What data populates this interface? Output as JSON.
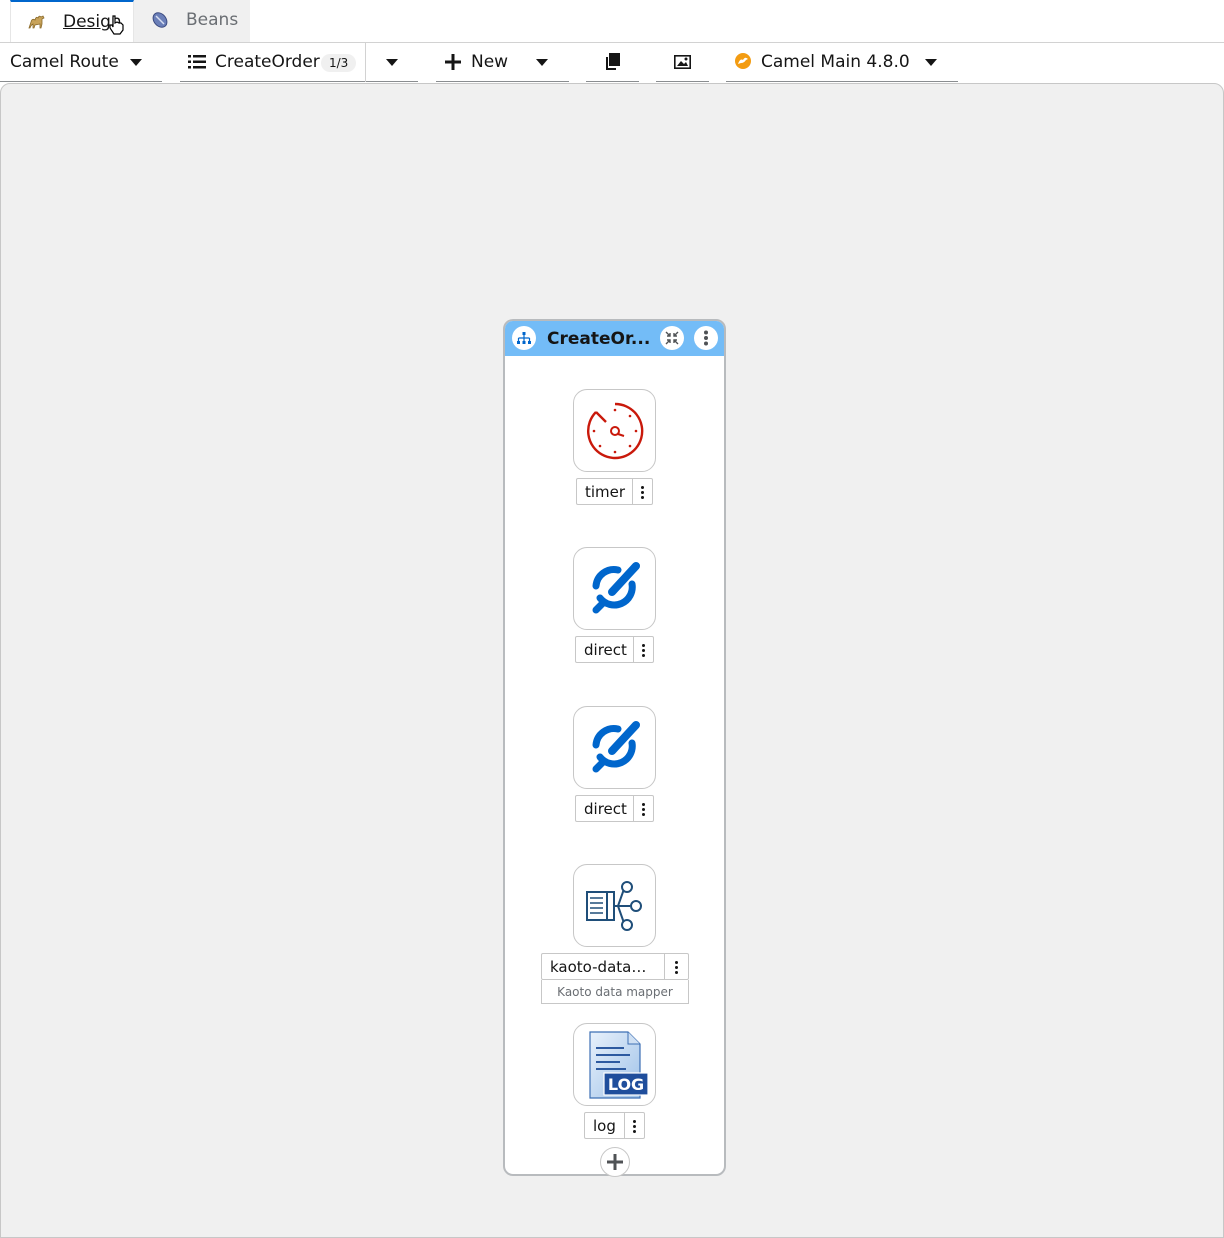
{
  "tabs": [
    {
      "label": "Design",
      "icon": "camel-icon"
    },
    {
      "label": "Beans",
      "icon": "bean-icon"
    }
  ],
  "toolbar": {
    "type_selector": "Camel Route",
    "route_selector": "CreateOrder",
    "route_count": "1/3",
    "new_label": "New",
    "runtime_selector": "Camel Main 4.8.0"
  },
  "route": {
    "title": "CreateOrder",
    "title_display": "CreateOr...",
    "header_color": "#73bcf7",
    "steps": [
      {
        "label": "timer",
        "icon": "timer-icon"
      },
      {
        "label": "direct",
        "icon": "direct-icon"
      },
      {
        "label": "direct",
        "icon": "direct-icon"
      },
      {
        "label": "kaoto-datama...",
        "description": "Kaoto data mapper",
        "icon": "datamapper-icon"
      },
      {
        "label": "log",
        "icon": "log-icon"
      }
    ]
  },
  "colors": {
    "accent": "#0066cc",
    "timer": "#c9190b",
    "direct": "#0066cc",
    "datamapper": "#1f4e79"
  }
}
